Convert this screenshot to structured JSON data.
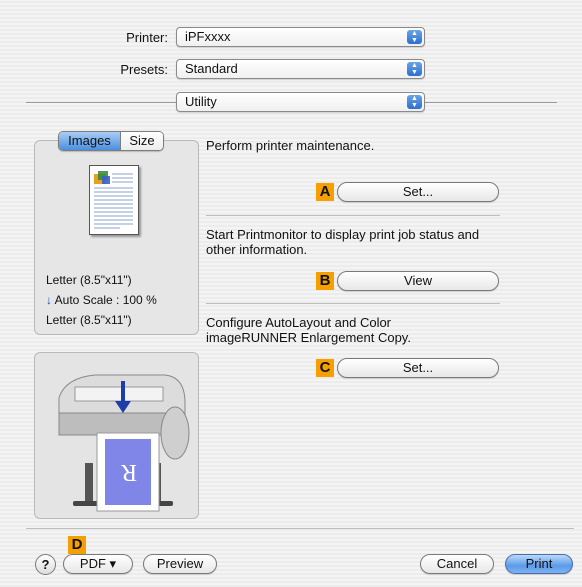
{
  "printer": {
    "label": "Printer:",
    "value": "iPFxxxx"
  },
  "presets": {
    "label": "Presets:",
    "value": "Standard"
  },
  "panel_select": {
    "value": "Utility"
  },
  "preview_tabs": [
    {
      "label": "Images"
    },
    {
      "label": "Size"
    }
  ],
  "paper_info": {
    "line1": "Letter (8.5\"x11\")",
    "line2": "Auto Scale : 100 %",
    "line3": "Letter (8.5\"x11\")"
  },
  "sections": [
    {
      "description": "Perform printer maintenance.",
      "marker": "A",
      "button": "Set..."
    },
    {
      "description": "Start Printmonitor to display print job status and other information.",
      "marker": "B",
      "button": "View"
    },
    {
      "description": "Configure AutoLayout and Color imageRUNNER Enlargement Copy.",
      "marker": "C",
      "button": "Set..."
    }
  ],
  "footer": {
    "help": "?",
    "marker": "D",
    "pdf": "PDF ▾",
    "preview": "Preview",
    "cancel": "Cancel",
    "print": "Print"
  },
  "colors": {
    "marker": "#f5a000",
    "accent": "#4a8fe0"
  }
}
